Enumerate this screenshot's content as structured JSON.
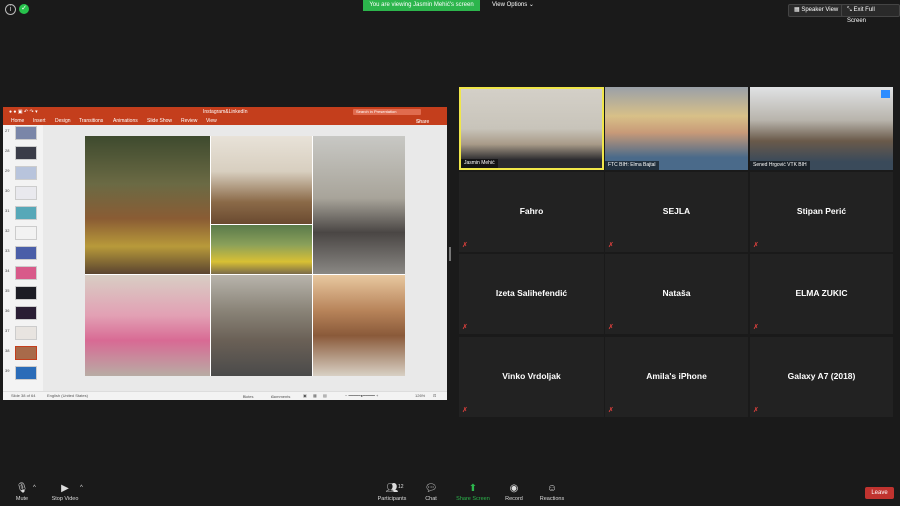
{
  "topbar": {
    "banner": "You are viewing Jasmin Mehić's screen",
    "view_options": "View Options",
    "speaker_view": "Speaker View",
    "exit_full_screen": "Exit Full Screen",
    "icons": [
      "info-icon",
      "shield-check-icon"
    ]
  },
  "ppt": {
    "doc_title": "Instagram&LinkedIn",
    "search_placeholder": "Search in Presentation",
    "tabs": [
      "Home",
      "Insert",
      "Design",
      "Transitions",
      "Animations",
      "Slide Show",
      "Review",
      "View"
    ],
    "share": "Share",
    "thumbs": [
      "27",
      "28",
      "29",
      "30",
      "31",
      "32",
      "33",
      "34",
      "35",
      "36",
      "37",
      "38",
      "39"
    ],
    "selected_thumb": "38",
    "status_slide": "Slide 38 of 64",
    "status_lang": "English (United States)",
    "status_notes": "Notes",
    "status_comments": "Comments",
    "status_zoom": "126%"
  },
  "gallery": {
    "video_tiles": [
      {
        "label": "Jasmin Mehić"
      },
      {
        "label": "FTC BIH: Elma Bajtal"
      },
      {
        "label": "Sened Hrgović VTK BIH"
      }
    ],
    "name_tiles": [
      "Fahro",
      "SEJLA",
      "Stipan Perić",
      "Izeta Salihefendić",
      "Nataša",
      "ELMA ZUKIC",
      "Vinko Vrdoljak",
      "Amila's iPhone",
      "Galaxy A7 (2018)"
    ]
  },
  "toolbar": {
    "mute": "Mute",
    "stop_video": "Stop Video",
    "participants": "Participants",
    "participants_count": "12",
    "chat": "Chat",
    "share_screen": "Share Screen",
    "record": "Record",
    "reactions": "Reactions",
    "leave": "Leave"
  },
  "colors": {
    "ppt_accent": "#c43e1c",
    "share_green": "#2cb54c",
    "leave_red": "#c0332f",
    "active_speaker": "#f0e64a"
  }
}
